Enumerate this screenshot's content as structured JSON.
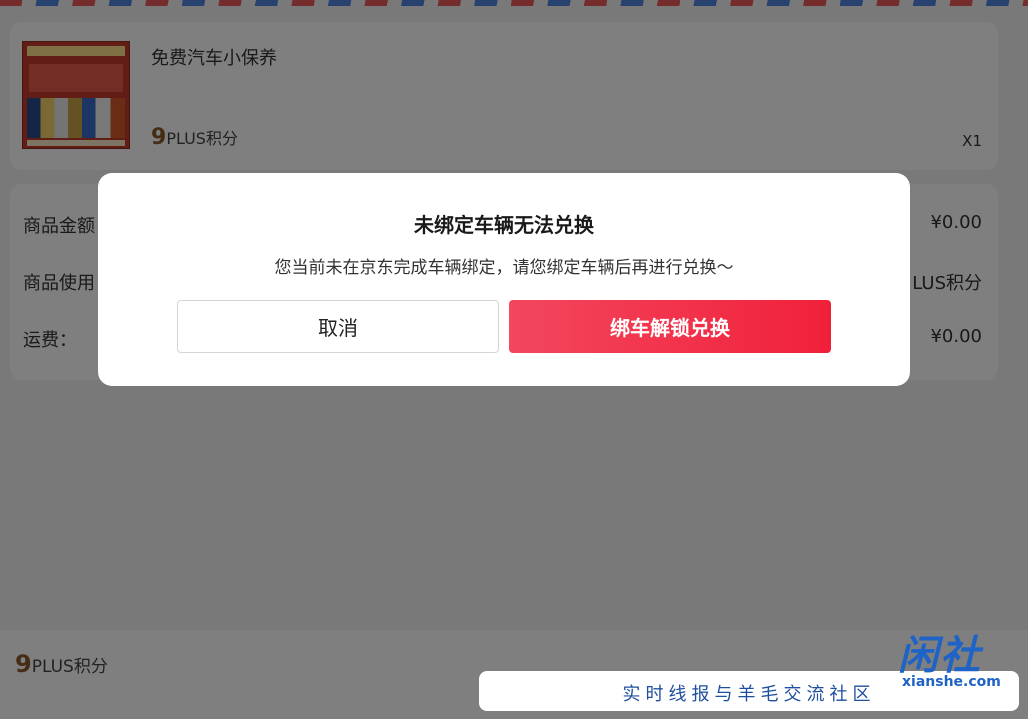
{
  "product": {
    "name": "免费汽车小保养",
    "price_number": "9",
    "price_unit": "PLUS积分",
    "quantity": "X1"
  },
  "summary": {
    "rows": [
      {
        "label": "商品金额",
        "value": "¥0.00"
      },
      {
        "label": "商品使用",
        "value": "LUS积分"
      },
      {
        "label": "运费：",
        "value": "¥0.00"
      }
    ]
  },
  "footer": {
    "price_number": "9",
    "price_unit": "PLUS积分"
  },
  "dialog": {
    "title": "未绑定车辆无法兑换",
    "message": "您当前未在京东完成车辆绑定，请您绑定车辆后再进行兑换～",
    "cancel_label": "取消",
    "confirm_label": "绑车解锁兑换"
  },
  "watermark": {
    "logo": "闲社",
    "url": "xianshe.com",
    "slogan": "实时线报与羊毛交流社区"
  },
  "colors": {
    "accent": "#f1203a",
    "price": "#8b5a2b"
  }
}
